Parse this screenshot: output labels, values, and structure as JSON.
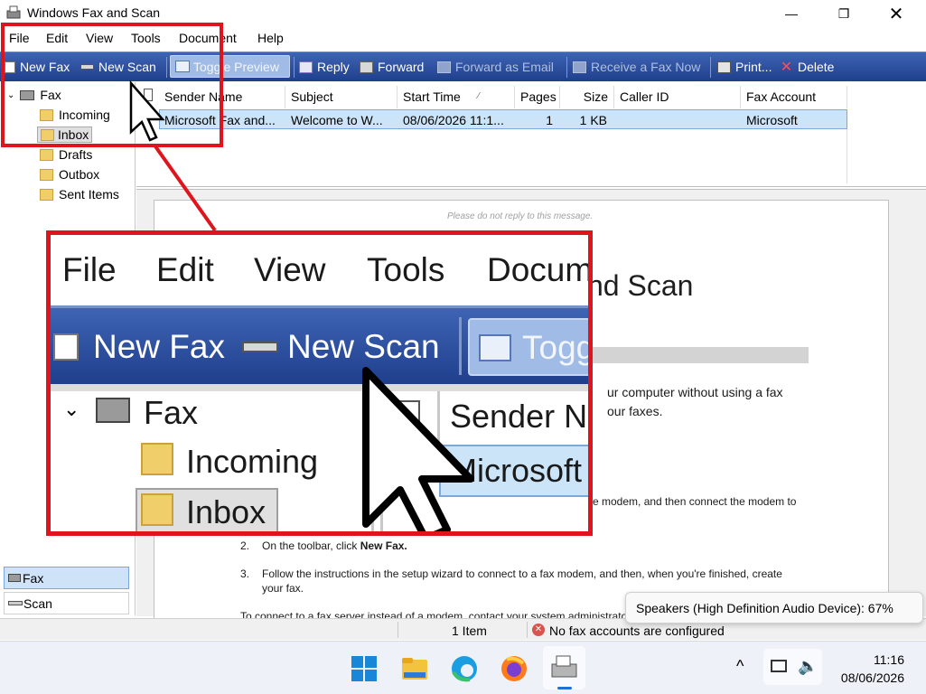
{
  "window": {
    "title": "Windows Fax and Scan"
  },
  "menu": [
    "File",
    "Edit",
    "View",
    "Tools",
    "Document",
    "Help"
  ],
  "toolbar": {
    "new_fax": "New Fax",
    "new_scan": "New Scan",
    "toggle_preview": "Toggle Preview",
    "reply": "Reply",
    "forward": "Forward",
    "forward_email": "Forward as Email",
    "receive_fax": "Receive a Fax Now",
    "print": "Print...",
    "delete": "Delete"
  },
  "tree": {
    "root": "Fax",
    "items": [
      "Incoming",
      "Inbox",
      "Drafts",
      "Outbox",
      "Sent Items"
    ]
  },
  "bottom_nav": [
    "Fax",
    "Scan"
  ],
  "list": {
    "columns": [
      "Sender Name",
      "Subject",
      "Start Time",
      "Pages",
      "Size",
      "Caller ID",
      "Fax Account"
    ],
    "rows": [
      {
        "sender": "Microsoft Fax and...",
        "subject": "Welcome to W...",
        "start": "08/06/2026 11:1...",
        "pages": "1",
        "size": "1 KB",
        "caller": "",
        "account": "Microsoft"
      }
    ]
  },
  "preview": {
    "note": "Please do not reply to this message.",
    "title_fragment": "nd Scan",
    "line1": "ur computer without using a fax",
    "line2": "our faxes.",
    "line3": "e modem, and then connect the modem to",
    "step2_num": "2.",
    "step2_pre": "On the toolbar, click ",
    "step2_bold": "New Fax.",
    "step3_num": "3.",
    "step3_a": "Follow the instructions in the setup wizard to connect to a fax modem, and then, when you're finished, create",
    "step3_b": "your fax.",
    "line_last": "To connect to a fax server instead of a modem, contact your system administrator"
  },
  "status": {
    "items": "1 Item",
    "accounts": "No fax accounts are configured"
  },
  "tooltip": "Speakers (High Definition Audio Device): 67%",
  "clock": {
    "time": "11:16",
    "date": "08/06/2026"
  },
  "colors": {
    "toolbar_top": "#3e64b4",
    "toolbar_bottom": "#1f3f8c",
    "callout": "#e0141c",
    "selection": "#cce4f7"
  }
}
